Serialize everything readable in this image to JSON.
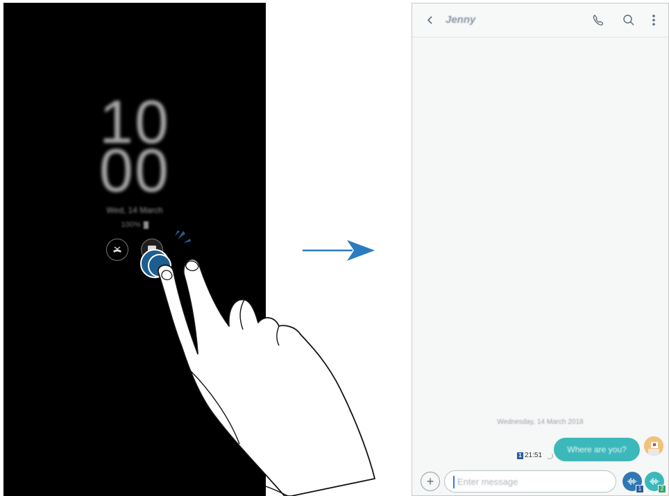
{
  "aod": {
    "clock_hours": "10",
    "clock_minutes": "00",
    "date": "Wed, 14 March",
    "battery": "100%",
    "icons": [
      "missed-call-icon",
      "message-icon"
    ]
  },
  "messages": {
    "contact_name": "Jenny",
    "date_separator": "Wednesday, 14 March 2018",
    "bubble_text": "Where are you?",
    "time": "21:51",
    "sim_number": "1",
    "input_placeholder": "Enter message",
    "voice_sim1": "1",
    "voice_sim2": "2"
  },
  "colors": {
    "accent_teal": "#3cb8ba",
    "accent_blue": "#2f78b4",
    "tap_blue": "#1d5d8f",
    "arrow_blue": "#2a7cc0"
  }
}
